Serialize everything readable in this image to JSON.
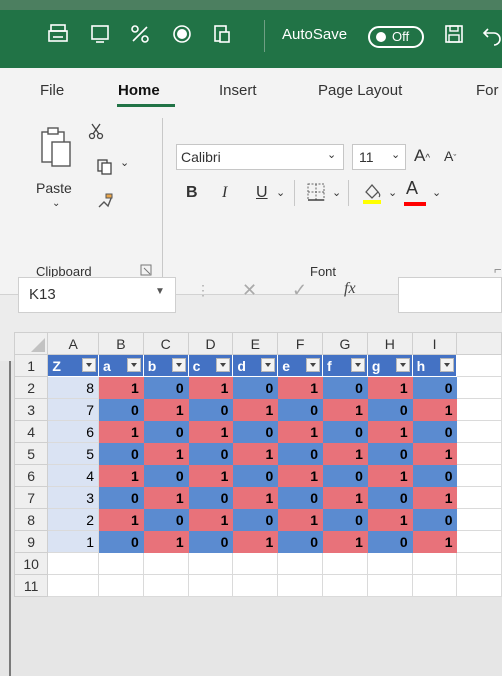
{
  "quick_access": {
    "icons": [
      "print-icon",
      "screen-icon",
      "percent-icon",
      "record-icon",
      "paste-icon"
    ],
    "autosave_label": "AutoSave",
    "autosave_state": "Off"
  },
  "ribbon": {
    "tabs": [
      "File",
      "Home",
      "Insert",
      "Page Layout",
      "For"
    ],
    "active_tab": "Home",
    "paste_label": "Paste",
    "font_name": "Calibri",
    "font_size": "11",
    "bold": "B",
    "italic": "I",
    "underline": "U",
    "grow_font": "A",
    "shrink_font": "A",
    "font_color_letter": "A",
    "groups": {
      "clipboard": "Clipboard",
      "font": "Font"
    },
    "colors": {
      "highlight": "#ffff00",
      "font_color": "#ff0000",
      "accent": "#217346"
    }
  },
  "formula_bar": {
    "name_box": "K13",
    "fx_label": "fx",
    "formula": ""
  },
  "sheet": {
    "columns": [
      "A",
      "B",
      "C",
      "D",
      "E",
      "F",
      "G",
      "H",
      "I"
    ],
    "header_row": [
      "Z",
      "a",
      "b",
      "c",
      "d",
      "e",
      "f",
      "g",
      "h"
    ],
    "rows": [
      {
        "row": "2",
        "z": "8",
        "values": [
          "1",
          "0",
          "1",
          "0",
          "1",
          "0",
          "1",
          "0"
        ]
      },
      {
        "row": "3",
        "z": "7",
        "values": [
          "0",
          "1",
          "0",
          "1",
          "0",
          "1",
          "0",
          "1"
        ]
      },
      {
        "row": "4",
        "z": "6",
        "values": [
          "1",
          "0",
          "1",
          "0",
          "1",
          "0",
          "1",
          "0"
        ]
      },
      {
        "row": "5",
        "z": "5",
        "values": [
          "0",
          "1",
          "0",
          "1",
          "0",
          "1",
          "0",
          "1"
        ]
      },
      {
        "row": "6",
        "z": "4",
        "values": [
          "1",
          "0",
          "1",
          "0",
          "1",
          "0",
          "1",
          "0"
        ]
      },
      {
        "row": "7",
        "z": "3",
        "values": [
          "0",
          "1",
          "0",
          "1",
          "0",
          "1",
          "0",
          "1"
        ]
      },
      {
        "row": "8",
        "z": "2",
        "values": [
          "1",
          "0",
          "1",
          "0",
          "1",
          "0",
          "1",
          "0"
        ]
      },
      {
        "row": "9",
        "z": "1",
        "values": [
          "0",
          "1",
          "0",
          "1",
          "0",
          "1",
          "0",
          "1"
        ]
      }
    ],
    "extra_rows": [
      "10",
      "11"
    ],
    "header_row_number": "1",
    "colors": {
      "header": "#4472c4",
      "red": "#e8727a",
      "blue": "#5b8bd0",
      "z_fill": "#dae3f3"
    }
  }
}
